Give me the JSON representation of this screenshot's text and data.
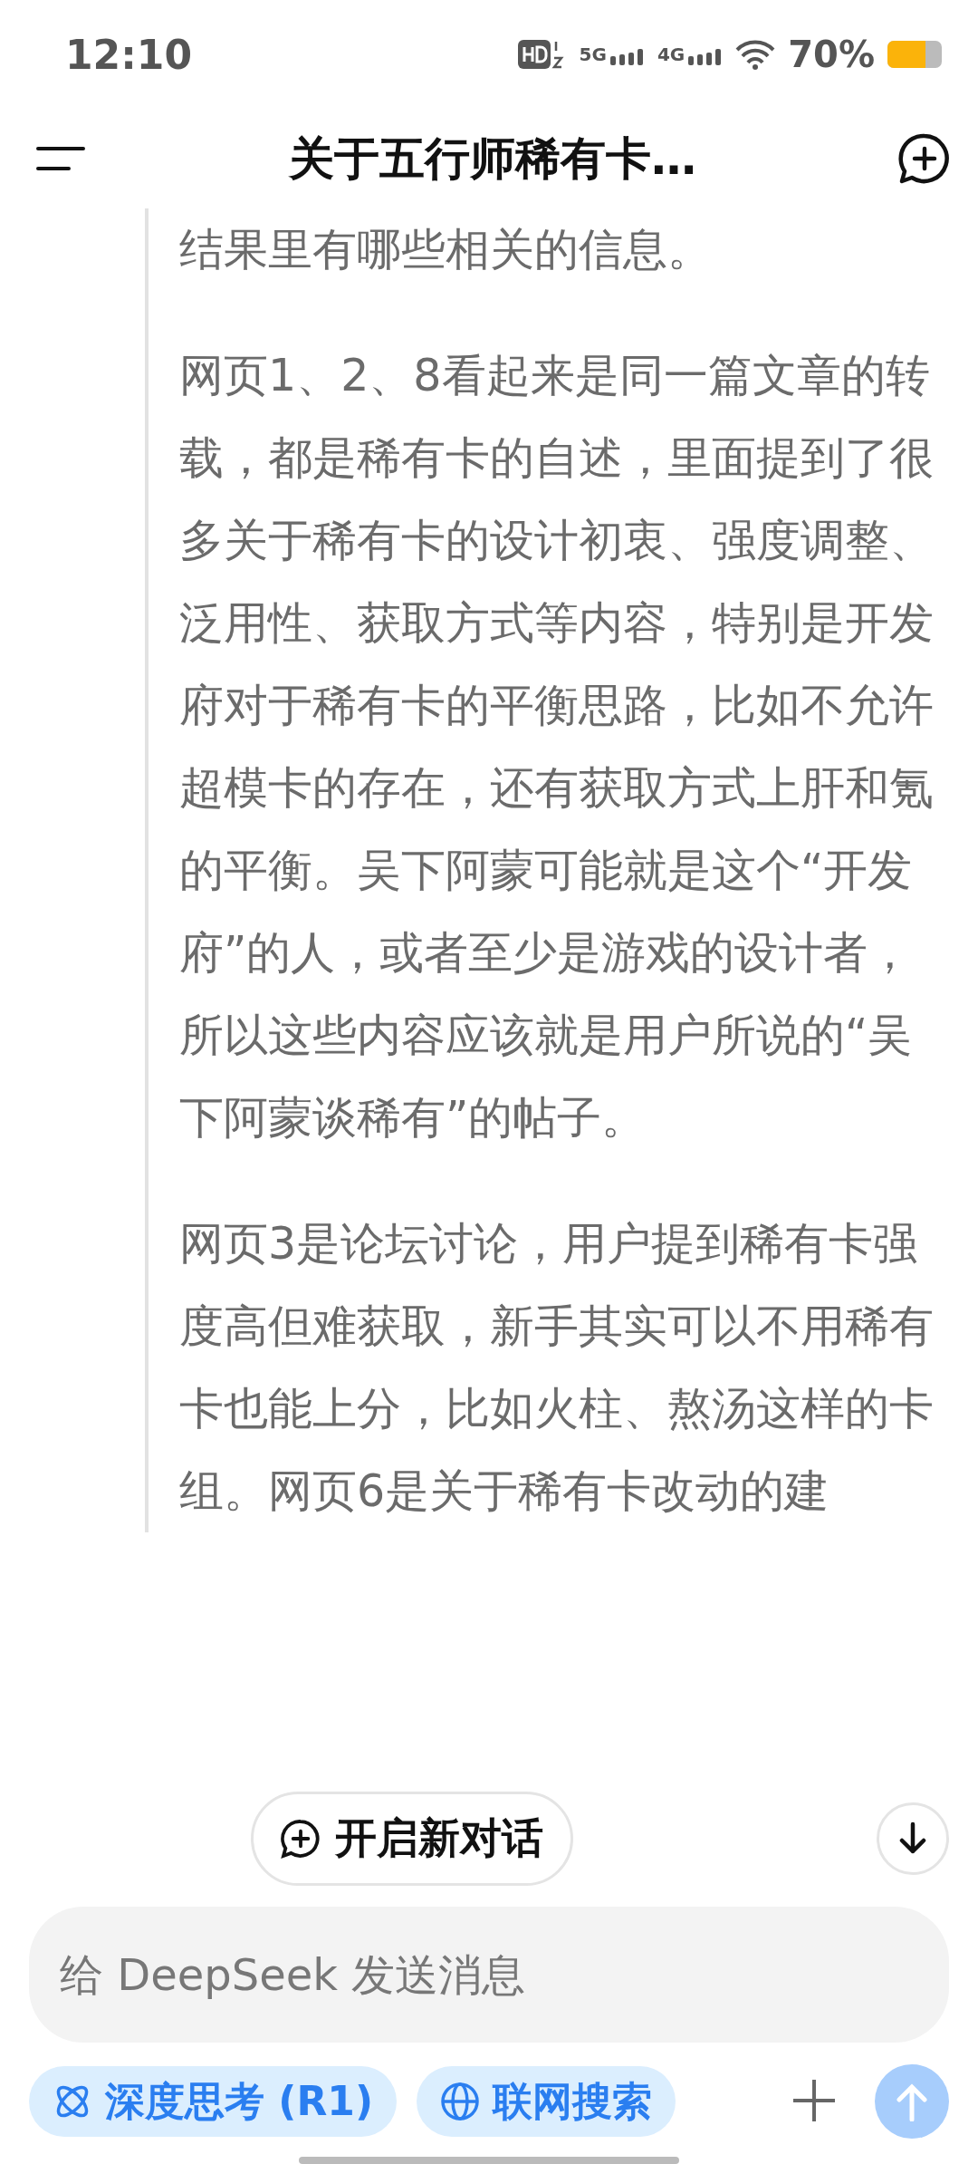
{
  "status_bar": {
    "time": "12:10",
    "signal_label_1": "5G",
    "signal_label_2": "4G",
    "battery_percent": "70%"
  },
  "header": {
    "title": "关于五行师稀有卡…"
  },
  "reasoning": {
    "paragraphs": [
      "结果里有哪些相关的信息。",
      "网页1、2、8看起来是同一篇文章的转载，都是稀有卡的自述，里面提到了很多关于稀有卡的设计初衷、强度调整、泛用性、获取方式等内容，特别是开发府对于稀有卡的平衡思路，比如不允许超模卡的存在，还有获取方式上肝和氪的平衡。吴下阿蒙可能就是这个“开发府”的人，或者至少是游戏的设计者，所以这些内容应该就是用户所说的“吴下阿蒙谈稀有”的帖子。",
      "网页3是论坛讨论，用户提到稀有卡强度高但难获取，新手其实可以不用稀有卡也能上分，比如火柱、熬汤这样的卡组。网页6是关于稀有卡改动的建"
    ]
  },
  "new_chat_button": {
    "label": "开启新对话"
  },
  "composer": {
    "placeholder": "给 DeepSeek 发送消息",
    "chips": [
      {
        "kind": "think",
        "label": "深度思考 (R1)",
        "selected": true
      },
      {
        "kind": "search",
        "label": "联网搜索",
        "selected": true
      }
    ],
    "send_disabled": true
  }
}
